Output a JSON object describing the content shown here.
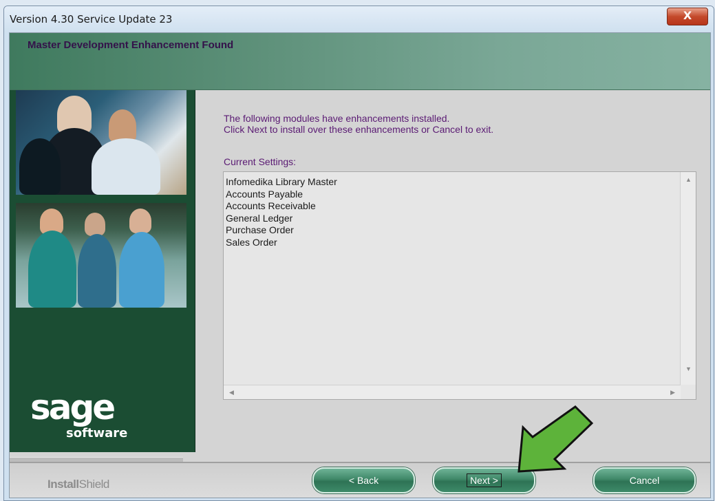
{
  "window": {
    "title": "Version 4.30 Service Update 23",
    "close_label": "X"
  },
  "header": {
    "title": "Master Development Enhancement Found"
  },
  "content": {
    "line1": "The following modules have enhancements installed.",
    "line2": "Click Next to install over these enhancements or Cancel to exit.",
    "settings_label": "Current Settings:",
    "items": [
      "Infomedika Library Master",
      "Accounts Payable",
      "Accounts Receivable",
      "General Ledger",
      "Purchase Order",
      "Sales Order"
    ]
  },
  "sidebar": {
    "logo_main": "sage",
    "logo_sub": "software"
  },
  "footer": {
    "installshield_bold": "Install",
    "installshield_light": "Shield",
    "back_label": "< Back",
    "next_label": "Next >",
    "cancel_label": "Cancel"
  },
  "colors": {
    "accent": "#5a1a73",
    "sidebar": "#1b4d33",
    "button": "#3f8868",
    "annotation_arrow": "#5db33a"
  }
}
